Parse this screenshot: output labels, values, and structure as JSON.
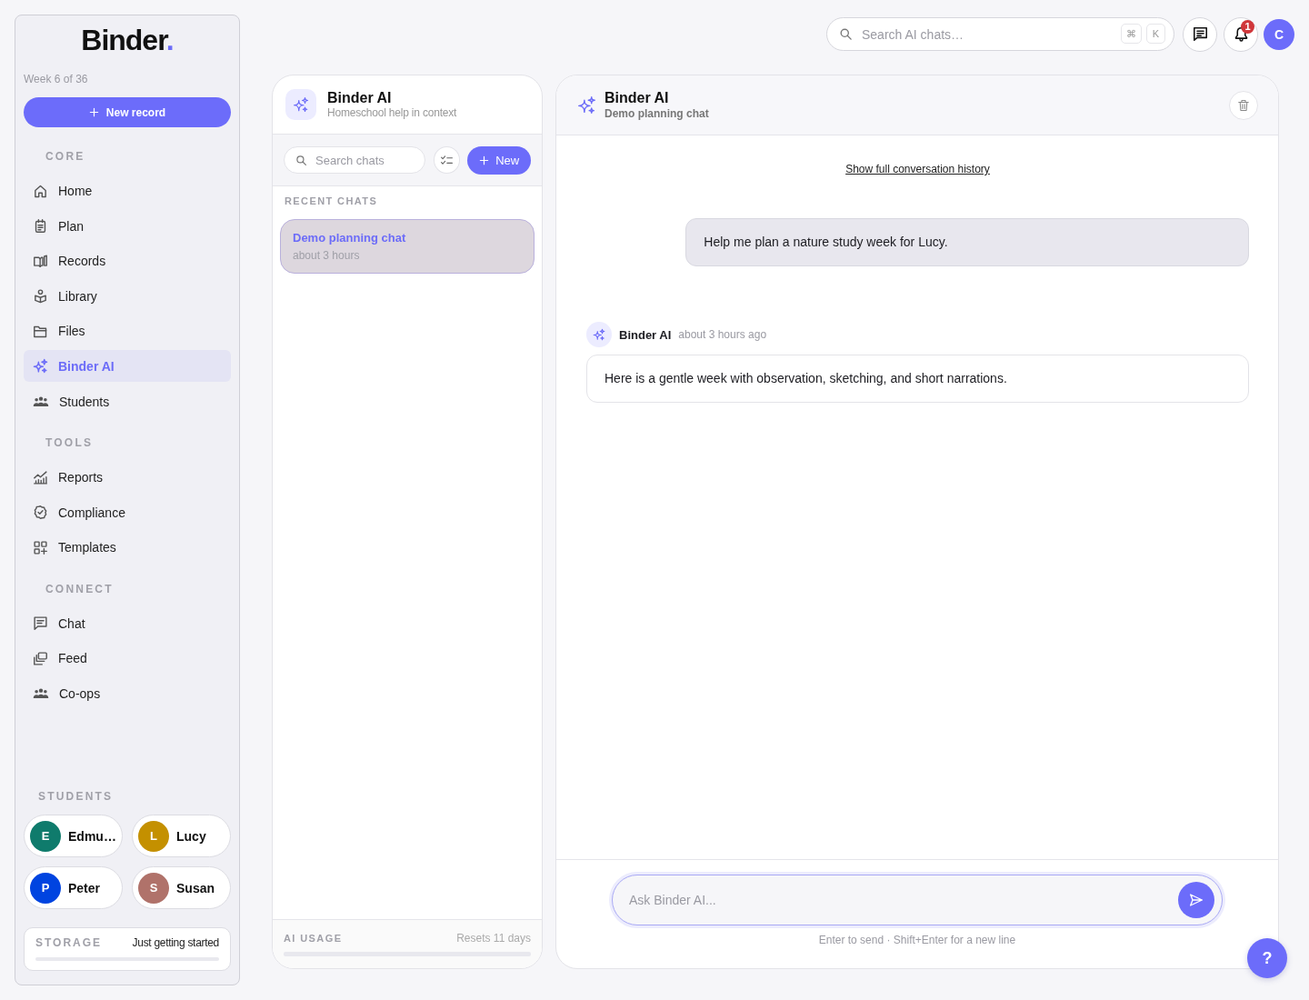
{
  "sidebar": {
    "logo": {
      "name": "Binder",
      "mark": "."
    },
    "week": "Week 6 of 36",
    "new_button": {
      "label": "New record"
    },
    "sections": [
      {
        "title": "CORE",
        "items": [
          {
            "label": "Home",
            "selected": false
          },
          {
            "label": "Plan",
            "selected": false
          },
          {
            "label": "Records",
            "selected": false
          },
          {
            "label": "Library",
            "selected": false
          },
          {
            "label": "Files",
            "selected": false
          },
          {
            "label": "Binder AI",
            "selected": true
          },
          {
            "label": "Students",
            "selected": false
          }
        ]
      },
      {
        "title": "TOOLS",
        "items": [
          {
            "label": "Reports",
            "selected": false
          },
          {
            "label": "Compliance",
            "selected": false
          },
          {
            "label": "Templates",
            "selected": false
          }
        ]
      },
      {
        "title": "CONNECT",
        "items": [
          {
            "label": "Chat",
            "selected": false
          },
          {
            "label": "Feed",
            "selected": false
          },
          {
            "label": "Co-ops",
            "selected": false
          }
        ]
      }
    ],
    "students": {
      "title": "STUDENTS",
      "items": [
        {
          "initial": "E",
          "name": "Edmu…",
          "color": "#0f7b6c"
        },
        {
          "initial": "L",
          "name": "Lucy",
          "color": "#c49000"
        },
        {
          "initial": "P",
          "name": "Peter",
          "color": "#0044e0"
        },
        {
          "initial": "S",
          "name": "Susan",
          "color": "#b0726a"
        }
      ]
    },
    "storage": {
      "label": "STORAGE",
      "status": "Just getting started",
      "level": 0
    }
  },
  "top_bar": {
    "search": {
      "placeholder": "Search AI chats…",
      "keys": [
        "⌘",
        "K"
      ]
    },
    "notifications": {
      "badge": "1"
    },
    "avatar": {
      "initial": "C"
    }
  },
  "chat_list": {
    "title": "Binder AI",
    "subtitle": "Homeschool help in context",
    "search": {
      "placeholder": "Search chats"
    },
    "new_button": {
      "label": "New"
    },
    "section": "RECENT CHATS",
    "chats": [
      {
        "title": "Demo planning chat",
        "time": "about 3 hours",
        "selected": true
      }
    ],
    "usage": {
      "label": "AI USAGE",
      "note": "Resets 11 days",
      "level": 0
    }
  },
  "conversation": {
    "title": "Binder AI",
    "subtitle": "Demo planning chat",
    "history_link": "Show full conversation history",
    "messages": [
      {
        "kind": "user",
        "text": "Help me plan a nature study week for Lucy."
      },
      {
        "kind": "assistant",
        "author": "Binder AI",
        "time": "about 3 hours ago",
        "text": "Here is a gentle week with observation, sketching, and short narrations."
      }
    ],
    "composer": {
      "placeholder": "Ask Binder AI...",
      "hint": "Enter to send · Shift+Enter for a new line"
    }
  },
  "help_button": {
    "label": "?"
  }
}
